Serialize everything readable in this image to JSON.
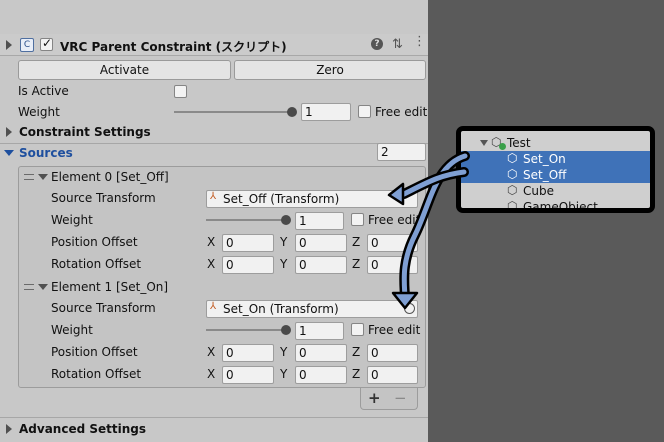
{
  "component": {
    "title": "VRC Parent Constraint (スクリプト)",
    "enabled": true
  },
  "actions": {
    "activate_label": "Activate",
    "zero_label": "Zero"
  },
  "top": {
    "is_active_label": "Is Active",
    "weight_label": "Weight",
    "weight_value": "1",
    "weight_slider_level": 1,
    "free_edit_label": "Free edit"
  },
  "constraint_settings_label": "Constraint Settings",
  "sources": {
    "label": "Sources",
    "count": "2",
    "elements": [
      {
        "header": "Element 0 [Set_Off]",
        "source_transform_label": "Source Transform",
        "source_transform_value": "Set_Off (Transform)",
        "weight_label": "Weight",
        "weight_value": "1",
        "free_edit_label": "Free edit",
        "position_offset_label": "Position Offset",
        "rotation_offset_label": "Rotation Offset",
        "x_label": "X",
        "y_label": "Y",
        "z_label": "Z",
        "position": [
          "0",
          "0",
          "0"
        ],
        "rotation": [
          "0",
          "0",
          "0"
        ]
      },
      {
        "header": "Element 1 [Set_On]",
        "source_transform_label": "Source Transform",
        "source_transform_value": "Set_On (Transform)",
        "weight_label": "Weight",
        "weight_value": "1",
        "free_edit_label": "Free edit",
        "position_offset_label": "Position Offset",
        "rotation_offset_label": "Rotation Offset",
        "x_label": "X",
        "y_label": "Y",
        "z_label": "Z",
        "position": [
          "0",
          "0",
          "0"
        ],
        "rotation": [
          "0",
          "0",
          "0"
        ]
      }
    ],
    "add_label": "+",
    "remove_label": "−"
  },
  "advanced_settings_label": "Advanced Settings",
  "hierarchy": {
    "items": [
      {
        "label": "Test",
        "selected": false
      },
      {
        "label": "Set_On",
        "selected": true
      },
      {
        "label": "Set_Off",
        "selected": true
      },
      {
        "label": "Cube",
        "selected": false
      },
      {
        "label": "GameObject",
        "selected": false
      }
    ]
  },
  "colors": {
    "selection": "#3f72b8",
    "sources_label": "#1e4f9e",
    "arrow_fill": "#7f9fd3"
  }
}
